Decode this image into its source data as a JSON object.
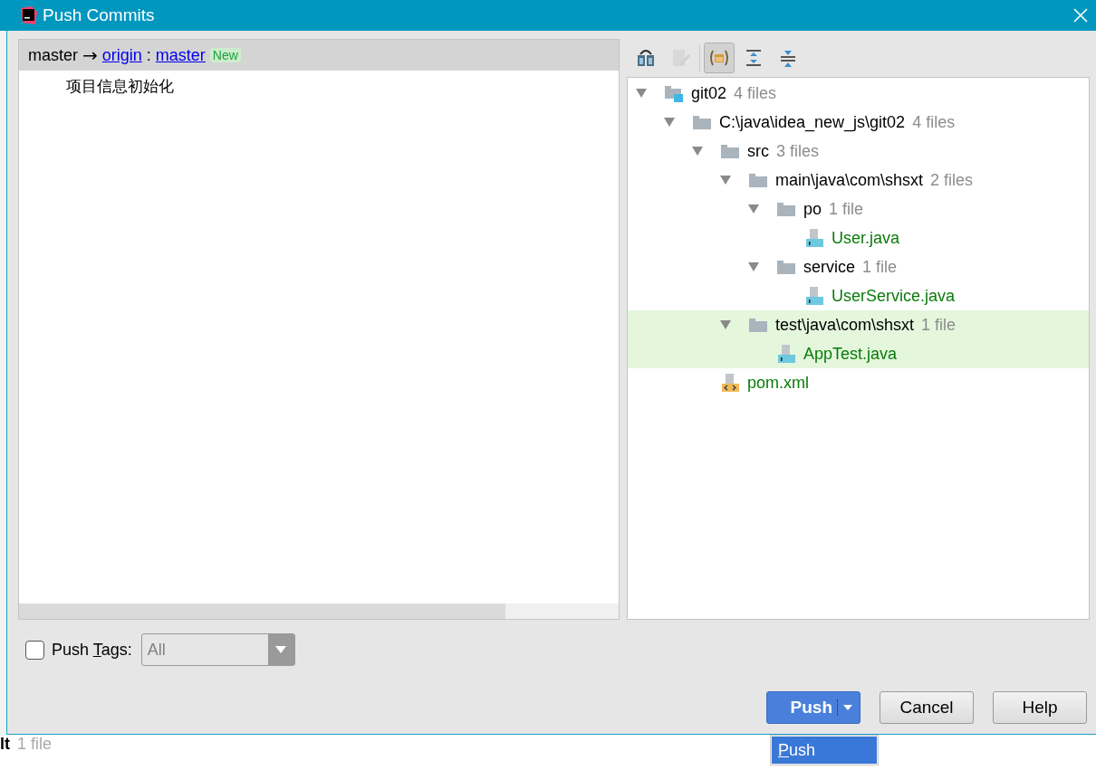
{
  "window": {
    "title": "Push Commits"
  },
  "push_list": {
    "local": "master",
    "arrow": "→",
    "remote": "origin",
    "separator": ":",
    "target": "master",
    "badge": "New",
    "commits": [
      "项目信息初始化"
    ]
  },
  "toolbar": [
    {
      "kind": "compare",
      "pressed": false,
      "disabled": false
    },
    {
      "kind": "edit",
      "pressed": false,
      "disabled": true
    },
    {
      "kind": "group",
      "pressed": true,
      "disabled": false
    },
    {
      "kind": "expand",
      "pressed": false,
      "disabled": false
    },
    {
      "kind": "collapse",
      "pressed": false,
      "disabled": false
    }
  ],
  "tree": [
    {
      "kind": "module",
      "name": "git02",
      "count": "4 files",
      "selected": false,
      "expanded": true,
      "children": [
        {
          "kind": "folder",
          "name": "C:\\java\\idea_new_js\\git02",
          "count": "4 files",
          "selected": false,
          "expanded": true,
          "children": [
            {
              "kind": "folder",
              "name": "src",
              "count": "3 files",
              "selected": false,
              "expanded": true,
              "children": [
                {
                  "kind": "folder",
                  "name": "main\\java\\com\\shsxt",
                  "count": "2 files",
                  "selected": false,
                  "expanded": true,
                  "children": [
                    {
                      "kind": "folder",
                      "name": "po",
                      "count": "1 file",
                      "selected": false,
                      "expanded": true,
                      "children": [
                        {
                          "kind": "java",
                          "name": "User.java",
                          "selected": false
                        }
                      ]
                    },
                    {
                      "kind": "folder",
                      "name": "service",
                      "count": "1 file",
                      "selected": false,
                      "expanded": true,
                      "children": [
                        {
                          "kind": "java",
                          "name": "UserService.java",
                          "selected": false
                        }
                      ]
                    }
                  ]
                },
                {
                  "kind": "folder",
                  "name": "test\\java\\com\\shsxt",
                  "count": "1 file",
                  "selected": true,
                  "expanded": true,
                  "children": [
                    {
                      "kind": "java",
                      "name": "AppTest.java",
                      "selected": true
                    }
                  ]
                }
              ]
            },
            {
              "kind": "xml",
              "name": "pom.xml",
              "selected": false
            }
          ]
        }
      ]
    }
  ],
  "push_tags": {
    "label": "Push ",
    "label_mnemonic": "T",
    "label_rest": "ags:",
    "checked": false,
    "value": "All"
  },
  "buttons": [
    {
      "kind": "split",
      "label": "Push"
    },
    {
      "kind": "plain",
      "label": "Cancel"
    },
    {
      "kind": "plain",
      "label": "Help"
    }
  ],
  "push_menu": [
    {
      "mnemonic": "P",
      "rest": "ush",
      "selected": true
    }
  ],
  "background": {
    "bold": "lt",
    "count": "1 file"
  }
}
